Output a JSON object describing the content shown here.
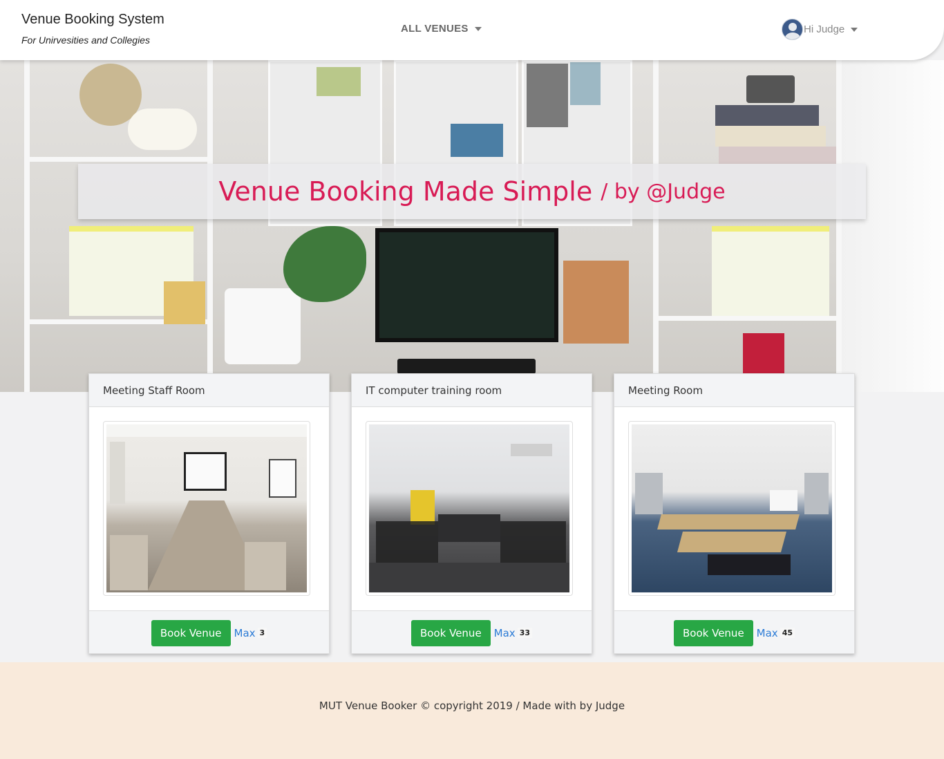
{
  "navbar": {
    "brand_title": "Venue Booking System",
    "brand_subtitle": "For Unirvesities and Collegies",
    "venues_menu": "ALL VENUES",
    "user_greeting": "Hi Judge"
  },
  "hero": {
    "title": "Venue Booking Made Simple",
    "byline": "/ by @Judge"
  },
  "venues": [
    {
      "name": "Meeting Staff Room",
      "book_label": "Book Venue",
      "max_label": "Max",
      "max_value": "3"
    },
    {
      "name": "IT computer training room",
      "book_label": "Book Venue",
      "max_label": "Max",
      "max_value": "33"
    },
    {
      "name": "Meeting Room",
      "book_label": "Book Venue",
      "max_label": "Max",
      "max_value": "45"
    }
  ],
  "footer": {
    "text": "MUT Venue Booker © copyright 2019 / Made with by Judge"
  },
  "colors": {
    "accent": "#d81b55",
    "book_button": "#28a745",
    "link": "#2b7bd6",
    "footer_bg": "#f9eadb"
  }
}
